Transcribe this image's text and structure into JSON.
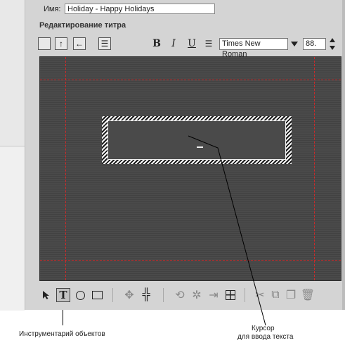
{
  "title_editor": {
    "name_label": "Имя:",
    "name_value": "Holiday - Happy Holidays",
    "section_title": "Редактирование титра",
    "toolbar": {
      "bold_label": "B",
      "italic_label": "I",
      "underline_label": "U",
      "font_family": "Times New Roman",
      "font_size": "88."
    },
    "canvas": {
      "background": "#4a4a4a",
      "safe_area_color": "#cc2a2a"
    },
    "tools": {
      "text_tool_label": "T"
    }
  },
  "annotations": {
    "tools_caption": "Инструментарий объектов",
    "cursor_caption_line1": "Курсор",
    "cursor_caption_line2": "для ввода текста"
  }
}
